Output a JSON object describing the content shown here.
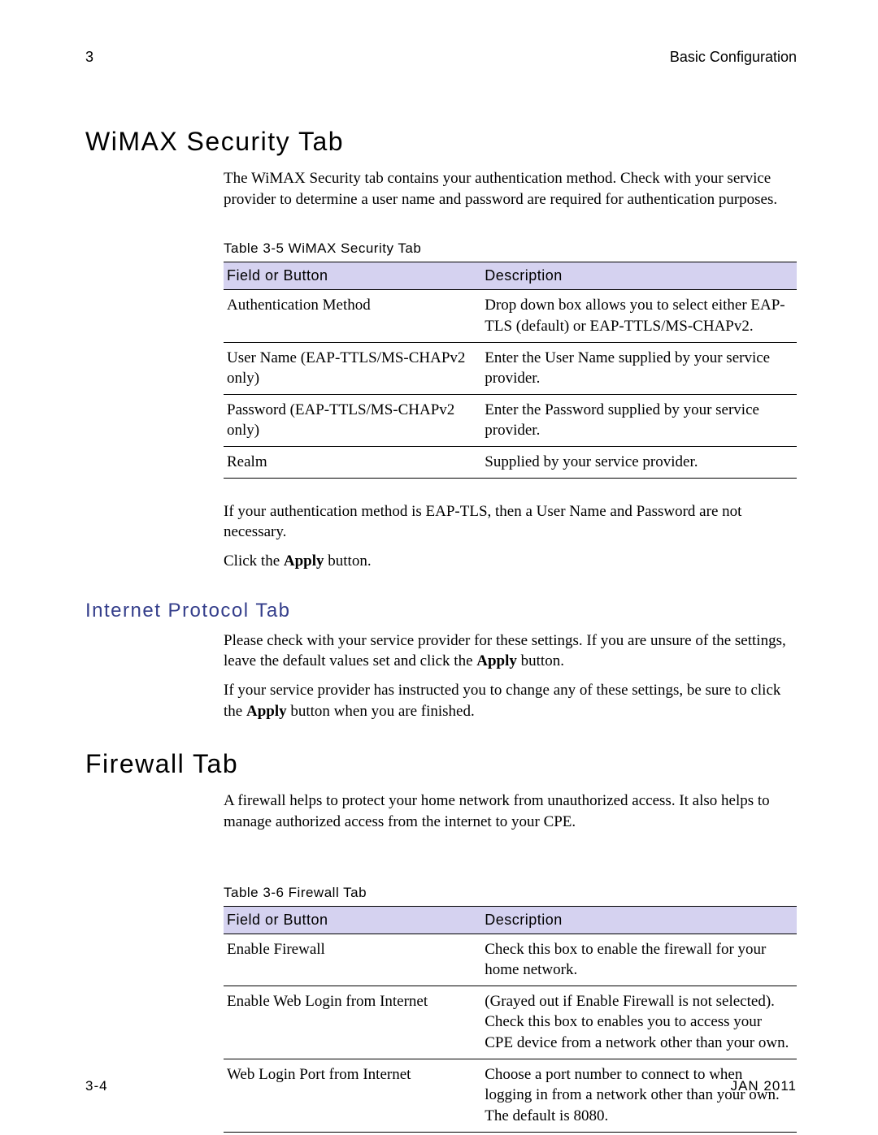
{
  "header": {
    "chapter_number": "3",
    "chapter_title": "Basic Configuration"
  },
  "sections": {
    "wimax": {
      "heading": "WiMAX Security Tab",
      "intro": "The WiMAX Security tab contains your authentication method. Check with your service provider to determine a user name and password are required for authentication purposes.",
      "table_caption": "Table 3-5 WiMAX Security Tab",
      "col_field": "Field or Button",
      "col_desc": "Description",
      "rows": [
        {
          "field": "Authentication Method",
          "desc": "Drop down box allows you to select either EAP-TLS (default) or EAP-TTLS/MS-CHAPv2."
        },
        {
          "field": "User Name (EAP-TTLS/MS-CHAPv2 only)",
          "desc": "Enter the User Name supplied by your service provider."
        },
        {
          "field": "Password (EAP-TTLS/MS-CHAPv2 only)",
          "desc": "Enter the Password supplied by your service provider."
        },
        {
          "field": "Realm",
          "desc": "Supplied by your service provider."
        }
      ],
      "after1": "If your authentication method is EAP-TLS, then a User Name and Password are not necessary.",
      "after2_pre": "Click the ",
      "after2_bold": "Apply",
      "after2_post": " button."
    },
    "ip": {
      "heading": "Internet Protocol Tab",
      "p1_pre": "Please check with your service provider for these settings. If you are unsure of the settings, leave the default values set and click the ",
      "p1_bold": "Apply",
      "p1_post": " button.",
      "p2_pre": "If your service provider has instructed you to change any of these settings, be sure to click the ",
      "p2_bold": "Apply",
      "p2_post": " button when you are finished."
    },
    "firewall": {
      "heading": "Firewall Tab",
      "intro": "A firewall helps to protect your home network from unauthorized access. It also helps to manage authorized access from the internet to your CPE.",
      "table_caption": "Table 3-6 Firewall Tab",
      "col_field": "Field or Button",
      "col_desc": "Description",
      "rows": [
        {
          "field": "Enable Firewall",
          "desc": "Check this box to enable the firewall for your home network."
        },
        {
          "field": "Enable Web Login from Internet",
          "desc": "(Grayed out if Enable Firewall is not selected).\nCheck this box to enables you to access your CPE device from a network other than your own."
        },
        {
          "field": "Web Login Port from Internet",
          "desc": "Choose a port number to connect to when logging in from a network other than your own. The default is 8080."
        }
      ]
    }
  },
  "footer": {
    "page": "3-4",
    "date": "JAN 2011"
  }
}
